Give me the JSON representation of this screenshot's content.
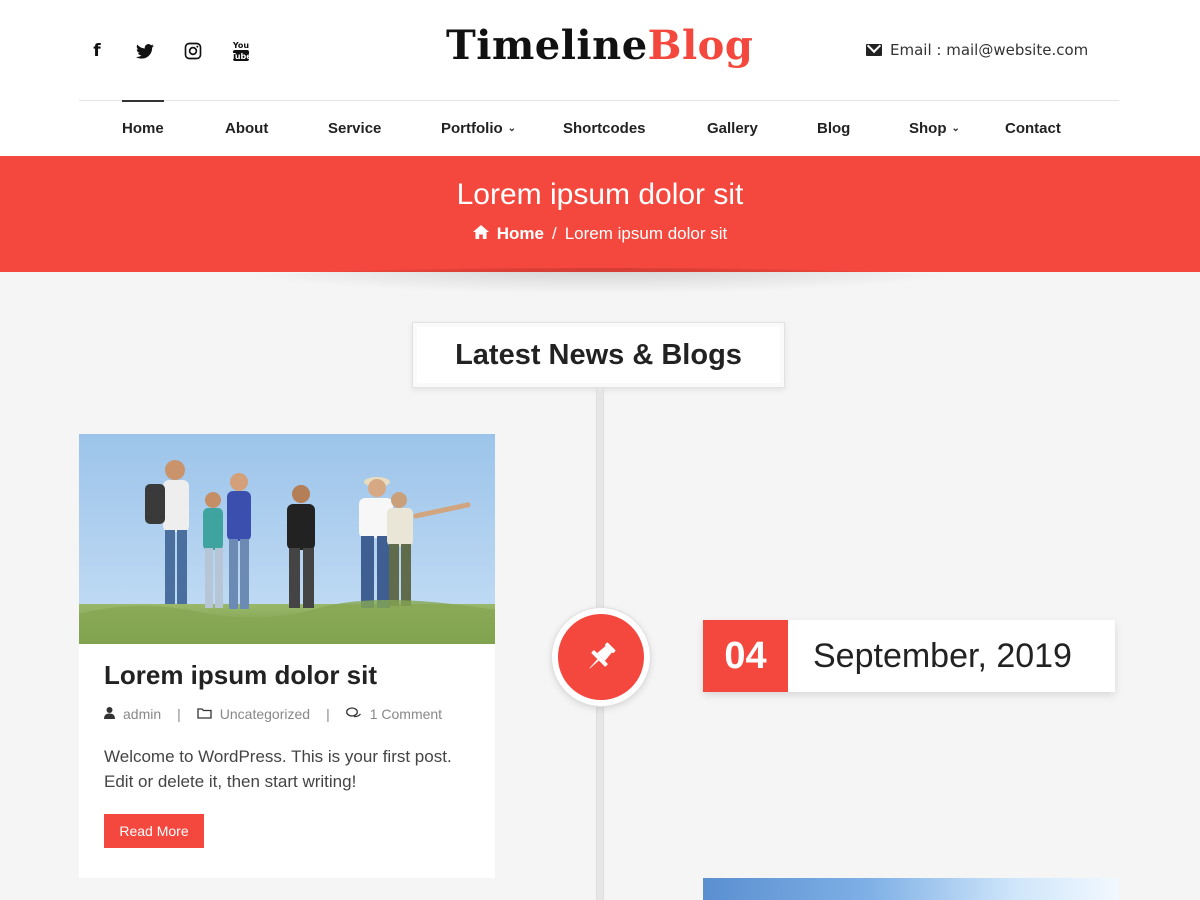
{
  "header": {
    "logo_part1": "Timeline",
    "logo_part2": "Blog",
    "email_label": "Email : mail@website.com",
    "social_icons": [
      "facebook-icon",
      "twitter-icon",
      "instagram-icon",
      "youtube-icon"
    ]
  },
  "nav": {
    "items": [
      {
        "label": "Home",
        "active": true
      },
      {
        "label": "About"
      },
      {
        "label": "Service"
      },
      {
        "label": "Portfolio",
        "has_submenu": true
      },
      {
        "label": "Shortcodes"
      },
      {
        "label": "Gallery"
      },
      {
        "label": "Blog"
      },
      {
        "label": "Shop",
        "has_submenu": true
      },
      {
        "label": "Contact"
      }
    ]
  },
  "banner": {
    "title": "Lorem ipsum dolor sit",
    "breadcrumb_home": "Home",
    "breadcrumb_sep": "/",
    "breadcrumb_current": "Lorem ipsum dolor sit"
  },
  "section": {
    "title": "Latest News & Blogs"
  },
  "post": {
    "title": "Lorem ipsum dolor sit",
    "author": "admin",
    "category": "Uncategorized",
    "comments": "1 Comment",
    "meta_sep": "|",
    "excerpt": "Welcome to WordPress. This is your first post. Edit or delete it, then start writing!",
    "read_more": "Read More",
    "date_day": "04",
    "date_month_year": "September, 2019"
  },
  "colors": {
    "accent": "#f4473d",
    "background": "#f5f5f5"
  }
}
